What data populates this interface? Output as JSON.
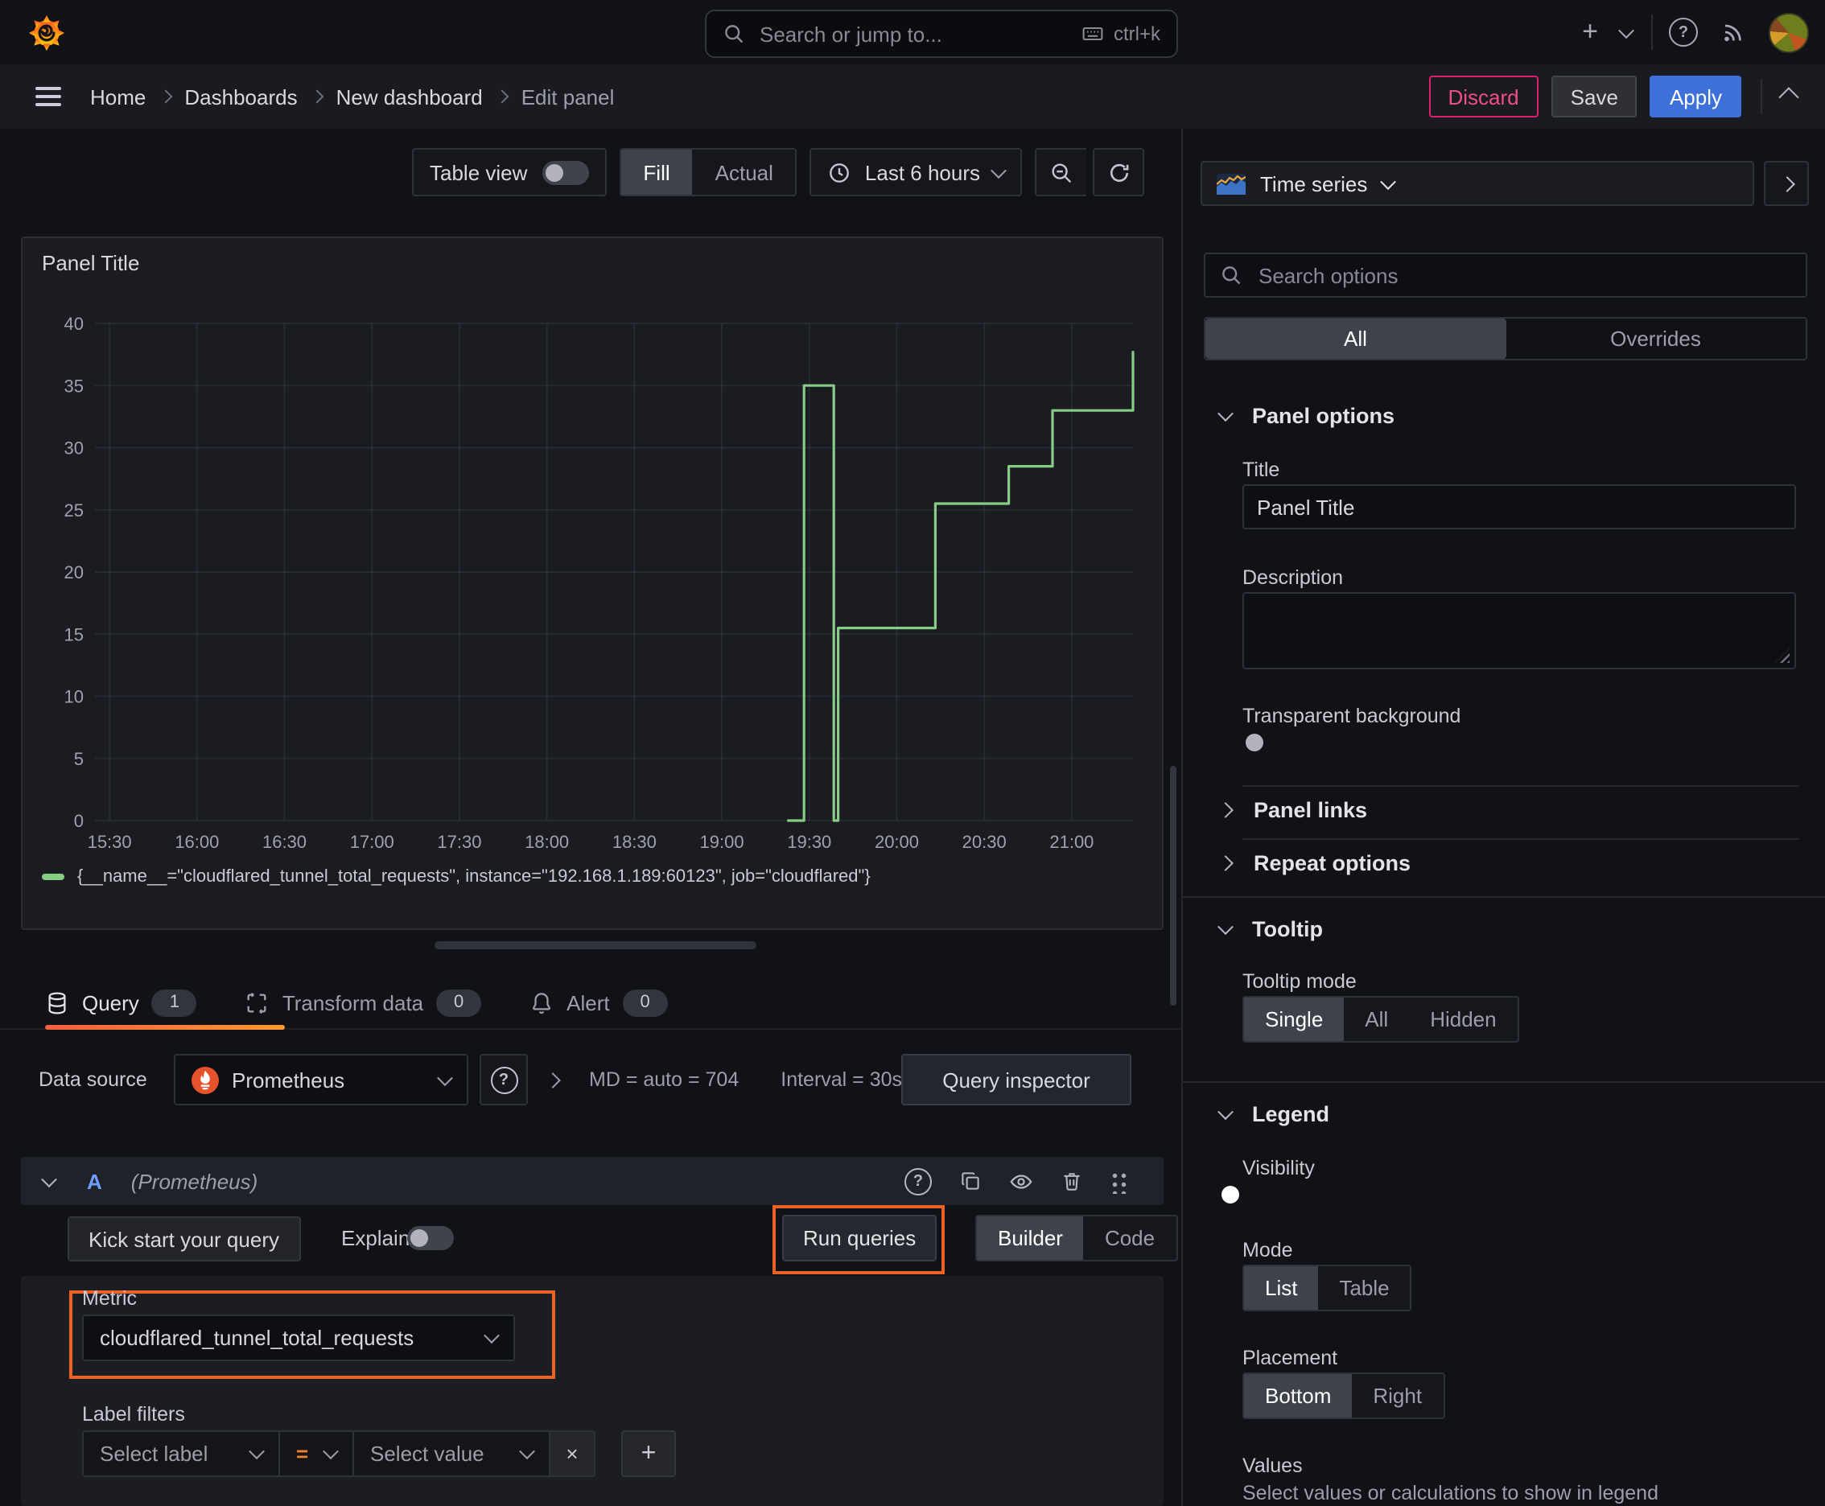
{
  "topnav": {
    "search_placeholder": "Search or jump to...",
    "search_shortcut": "ctrl+k"
  },
  "breadcrumb": {
    "items": [
      "Home",
      "Dashboards",
      "New dashboard",
      "Edit panel"
    ]
  },
  "actions": {
    "discard": "Discard",
    "save": "Save",
    "apply": "Apply"
  },
  "toolbar": {
    "table_view": "Table view",
    "fill": "Fill",
    "actual": "Actual",
    "time_range": "Last 6 hours"
  },
  "panel": {
    "title": "Panel Title"
  },
  "chart_data": {
    "type": "line",
    "step": true,
    "title": "Panel Title",
    "x_type": "time",
    "xlim": [
      15.4167,
      21.35
    ],
    "ylim": [
      0,
      40
    ],
    "grid": true,
    "legend_position": "bottom",
    "y_ticks": [
      0,
      5,
      10,
      15,
      20,
      25,
      30,
      35,
      40
    ],
    "x_ticks": [
      {
        "t": 15.5,
        "label": "15:30"
      },
      {
        "t": 16.0,
        "label": "16:00"
      },
      {
        "t": 16.5,
        "label": "16:30"
      },
      {
        "t": 17.0,
        "label": "17:00"
      },
      {
        "t": 17.5,
        "label": "17:30"
      },
      {
        "t": 18.0,
        "label": "18:00"
      },
      {
        "t": 18.5,
        "label": "18:30"
      },
      {
        "t": 19.0,
        "label": "19:00"
      },
      {
        "t": 19.5,
        "label": "19:30"
      },
      {
        "t": 20.0,
        "label": "20:00"
      },
      {
        "t": 20.5,
        "label": "20:30"
      },
      {
        "t": 21.0,
        "label": "21:00"
      }
    ],
    "series": [
      {
        "name": "{__name__=\"cloudflared_tunnel_total_requests\", instance=\"192.168.1.189:60123\", job=\"cloudflared\"}",
        "color": "#87cc85",
        "points": [
          [
            19.38,
            0
          ],
          [
            19.47,
            0
          ],
          [
            19.47,
            35
          ],
          [
            19.64,
            35
          ],
          [
            19.64,
            0
          ],
          [
            19.665,
            0
          ],
          [
            19.665,
            15.5
          ],
          [
            20.22,
            15.5
          ],
          [
            20.22,
            25.5
          ],
          [
            20.64,
            25.5
          ],
          [
            20.64,
            28.5
          ],
          [
            20.89,
            28.5
          ],
          [
            20.89,
            33
          ],
          [
            21.35,
            33
          ],
          [
            21.35,
            37.7
          ]
        ]
      }
    ]
  },
  "tabs": {
    "query": "Query",
    "query_count": "1",
    "transform": "Transform data",
    "transform_count": "0",
    "alert": "Alert",
    "alert_count": "0"
  },
  "query": {
    "datasource_label": "Data source",
    "datasource": "Prometheus",
    "stats_md": "MD = auto = 704",
    "stats_interval": "Interval = 30s",
    "inspector": "Query inspector",
    "ref_id": "A",
    "ref_ds": "(Prometheus)",
    "kickstart": "Kick start your query",
    "explain": "Explain",
    "run": "Run queries",
    "builder": "Builder",
    "code": "Code",
    "metric_label": "Metric",
    "metric_value": "cloudflared_tunnel_total_requests",
    "label_filters_label": "Label filters",
    "select_label": "Select label",
    "operator": "=",
    "select_value": "Select value"
  },
  "options": {
    "viz_type": "Time series",
    "search_placeholder": "Search options",
    "tab_all": "All",
    "tab_overrides": "Overrides",
    "panel_options": "Panel options",
    "title_label": "Title",
    "title_value": "Panel Title",
    "description_label": "Description",
    "transparent_bg": "Transparent background",
    "panel_links": "Panel links",
    "repeat_options": "Repeat options",
    "tooltip": "Tooltip",
    "tooltip_mode": "Tooltip mode",
    "tooltip_single": "Single",
    "tooltip_all": "All",
    "tooltip_hidden": "Hidden",
    "legend": "Legend",
    "visibility": "Visibility",
    "mode": "Mode",
    "mode_list": "List",
    "mode_table": "Table",
    "placement": "Placement",
    "placement_bottom": "Bottom",
    "placement_right": "Right",
    "values": "Values",
    "values_hint": "Select values or calculations to show in legend"
  },
  "colors": {
    "accent_orange": "#eb6324",
    "series_green": "#87cc85",
    "primary_blue": "#3d71d9",
    "danger_pink": "#e0226e"
  }
}
